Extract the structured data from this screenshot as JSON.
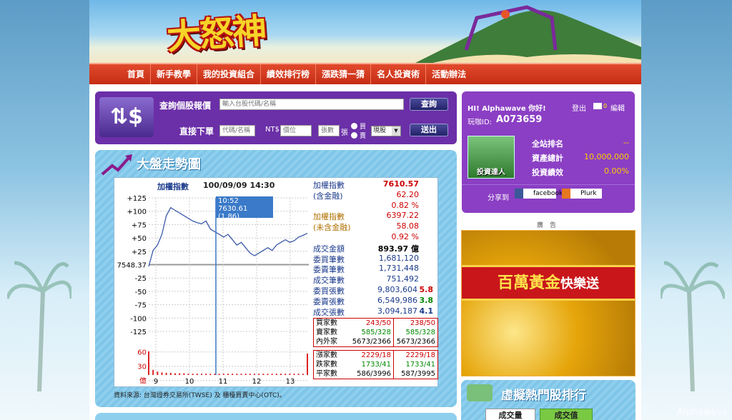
{
  "header": {
    "logo_text": "大怒神"
  },
  "nav": [
    "首頁",
    "新手教學",
    "我的投資組合",
    "績效排行榜",
    "漲跌猜一猜",
    "名人投資術",
    "活動辦法"
  ],
  "query": {
    "label": "查詢個股報價",
    "placeholder": "輸入台股代碼/名稱",
    "search_btn": "查詢",
    "order_label": "直接下單",
    "code_ph": "代碼/名稱",
    "nt_label": "NT$",
    "price_ph": "價位",
    "qty_ph": "張數",
    "unit": "張",
    "buy": "買",
    "sell": "賣",
    "type": "現股",
    "send_btn": "送出"
  },
  "user": {
    "greet": "HI! Alphawave 你好!",
    "logout": "登出",
    "mail_count": "0",
    "edit": "編輯",
    "id_label": "玩咖ID:",
    "id": "A073659",
    "badge": "投資達人",
    "rank_label": "全站排名",
    "rank": "--",
    "asset_label": "資產總計",
    "asset": "10,000,000",
    "perf_label": "投資績效",
    "perf": "0.00%",
    "share": "分享到",
    "fb": "facebook",
    "plurk": "Plurk"
  },
  "ad": {
    "label": "廣　告",
    "text1": "百萬黃金",
    "text2": "快樂送"
  },
  "hot": {
    "title": "虛擬熱門股排行",
    "tab1": "成交量",
    "tab2": "成交值"
  },
  "market": {
    "title": "大盤走勢圖",
    "chart_title": "加權指數",
    "datetime": "100/09/09 14:30",
    "tooltip_time": "10:52",
    "tooltip_val": "7630.61 (1.86)",
    "source": "資料來源: 台灣證券交易所(TWSE) 及 櫃檯買賣中心(OTC)。",
    "stats": [
      {
        "l": "加權指數",
        "v": "7610.57",
        "c": "#c00"
      },
      {
        "l": "(含金融)",
        "v": "62.20",
        "c": "#c00"
      },
      {
        "l": "",
        "v": "0.82 %",
        "c": "#c00"
      },
      {
        "l": "加權指數",
        "v": "6397.22",
        "c": "#c00"
      },
      {
        "l": "(未含金融)",
        "v": "58.08",
        "c": "#c00"
      },
      {
        "l": "",
        "v": "0.92 %",
        "c": "#c00"
      },
      {
        "l": "成交金額",
        "v": "893.97 億",
        "c": "#000"
      },
      {
        "l": "委買筆數",
        "v": "1,681,120",
        "c": "#1a3a8c"
      },
      {
        "l": "委賣筆數",
        "v": "1,731,448",
        "c": "#1a3a8c"
      },
      {
        "l": "成交筆數",
        "v": "751,492",
        "c": "#1a3a8c"
      },
      {
        "l": "委買張數",
        "v": "9,803,604",
        "c": "#1a3a8c",
        "x": "5.8",
        "xc": "#c00"
      },
      {
        "l": "委賣張數",
        "v": "6,549,986",
        "c": "#1a3a8c",
        "x": "3.8",
        "xc": "#080"
      },
      {
        "l": "成交張數",
        "v": "3,094,187",
        "c": "#1a3a8c",
        "x": "4.1",
        "xc": "#1a3a8c"
      }
    ],
    "box1": [
      [
        "買家數",
        "243/50",
        "238/50"
      ],
      [
        "賣家數",
        "585/328",
        "585/328"
      ],
      [
        "內外家",
        "5673/2366",
        "5673/2366"
      ]
    ],
    "box2": [
      [
        "漲家數",
        "2229/18",
        "2229/18"
      ],
      [
        "跌家數",
        "1733/41",
        "1733/41"
      ],
      [
        "平家數",
        "586/3996",
        "587/3995"
      ]
    ]
  },
  "chart_data": {
    "type": "line",
    "title": "加權指數",
    "base": 7548.37,
    "y_ticks": [
      "+125",
      "+100",
      "+75",
      "+50",
      "+25",
      "7548.37",
      "-25",
      "-50",
      "-75",
      "-100",
      "-125"
    ],
    "vol_ticks": [
      "60",
      "30",
      "億"
    ],
    "x_ticks": [
      "9",
      "10",
      "11",
      "12",
      "13"
    ],
    "values": [
      0,
      30,
      40,
      60,
      95,
      110,
      105,
      100,
      95,
      90,
      85,
      82,
      80,
      85,
      70,
      65,
      60,
      55,
      60,
      50,
      40,
      45,
      35,
      25,
      20,
      25,
      30,
      35,
      30,
      40,
      45,
      50,
      45,
      48,
      55,
      58,
      62
    ],
    "volume": [
      55,
      12,
      8,
      6,
      5,
      5,
      4,
      4,
      4,
      3,
      3,
      3,
      3,
      3,
      3,
      3,
      3,
      3,
      3,
      3,
      3,
      3,
      3,
      3,
      3,
      3,
      3,
      3,
      3,
      3,
      3,
      3,
      3,
      3,
      3,
      3,
      50
    ]
  }
}
